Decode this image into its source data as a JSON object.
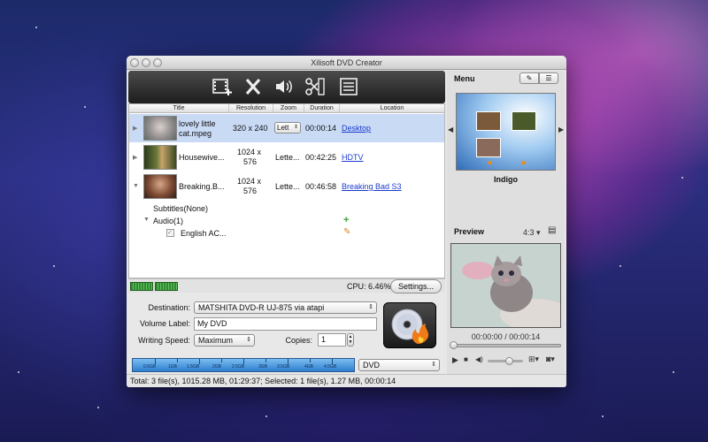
{
  "window": {
    "title": "Xilisoft DVD Creator"
  },
  "toolbar": {
    "buttons": [
      {
        "name": "add-video",
        "icon": "film-add-icon"
      },
      {
        "name": "remove",
        "icon": "close-x-icon"
      },
      {
        "name": "audio",
        "icon": "speaker-icon"
      },
      {
        "name": "clip",
        "icon": "scissors-film-icon"
      },
      {
        "name": "menu",
        "icon": "menu-list-icon"
      }
    ]
  },
  "file_list": {
    "columns": [
      "Title",
      "Resolution",
      "Zoom",
      "Duration",
      "Location"
    ],
    "rows": [
      {
        "title_line1": "lovely little",
        "title_line2": "cat.mpeg",
        "resolution": "320 x 240",
        "zoom": "Lett",
        "duration": "00:00:14",
        "location": "Desktop",
        "selected": true
      },
      {
        "title_line1": "Housewive...",
        "title_line2": "",
        "resolution_line1": "1024 x",
        "resolution_line2": "576",
        "zoom": "Lette...",
        "duration": "00:42:25",
        "location": "HDTV",
        "selected": false
      },
      {
        "title_line1": "Breaking.B...",
        "title_line2": "",
        "resolution_line1": "1024 x",
        "resolution_line2": "576",
        "zoom": "Lette...",
        "duration": "00:46:58",
        "location": "Breaking Bad S3",
        "selected": false
      }
    ],
    "subtitles": "Subtitles(None)",
    "audio": "Audio(1)",
    "audio_track": "English AC..."
  },
  "cpu": {
    "label": "CPU: 6.46%",
    "settings_button": "Settings..."
  },
  "form": {
    "destination_label": "Destination:",
    "destination_value": "MATSHITA DVD-R UJ-875 via atapi",
    "volume_label": "Volume Label:",
    "volume_value": "My DVD",
    "writing_speed_label": "Writing Speed:",
    "writing_speed_value": "Maximum",
    "copies_label": "Copies:",
    "copies_value": "1"
  },
  "capacity": {
    "ticks": [
      "0.5GB",
      "1GB",
      "1.5GB",
      "2GB",
      "2.5GB",
      "3GB",
      "3.5GB",
      "4GB",
      "4.5GB"
    ],
    "disc_type": "DVD"
  },
  "status": {
    "text": "Total: 3 file(s), 1015.28 MB,  01:29:37; Selected: 1 file(s), 1.27 MB,  00:00:14"
  },
  "menu_panel": {
    "title": "Menu",
    "template_name": "Indigo"
  },
  "preview_panel": {
    "title": "Preview",
    "aspect": "4:3",
    "time": "00:00:00 / 00:00:14"
  },
  "colors": {
    "selection": "#c9daf5",
    "link": "#1a3ccc",
    "toolbar": "#2a2a2a",
    "capacity": "#4a9be0"
  }
}
